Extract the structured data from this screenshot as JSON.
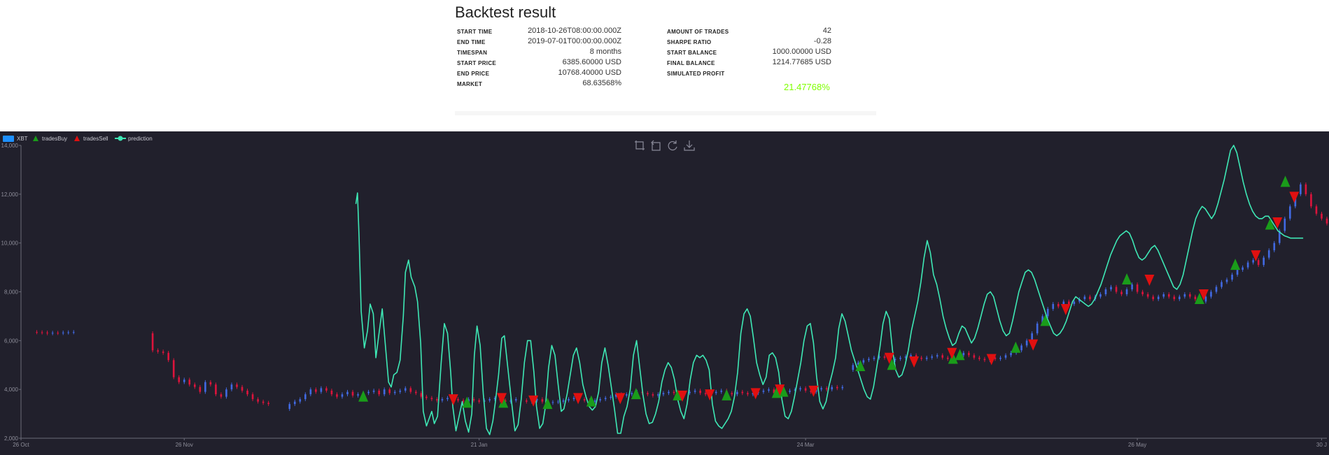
{
  "report": {
    "title": "Backtest result",
    "left_stats": [
      {
        "label": "START TIME",
        "value": "2018-10-26T08:00:00.000Z"
      },
      {
        "label": "END TIME",
        "value": "2019-07-01T00:00:00.000Z"
      },
      {
        "label": "TIMESPAN",
        "value": "8 months"
      },
      {
        "label": "START PRICE",
        "value": "6385.60000 USD"
      },
      {
        "label": "END PRICE",
        "value": "10768.40000 USD"
      },
      {
        "label": "MARKET",
        "value": "68.63568%"
      }
    ],
    "right_stats": [
      {
        "label": "AMOUNT OF TRADES",
        "value": "42"
      },
      {
        "label": "SHARPE RATIO",
        "value": "-0.28"
      },
      {
        "label": "START BALANCE",
        "value": "1000.00000 USD"
      },
      {
        "label": "FINAL BALANCE",
        "value": "1214.77685 USD"
      },
      {
        "label": "SIMULATED PROFIT",
        "value": ""
      }
    ],
    "profit": "21.47768%",
    "profit_color": "#7fff00"
  },
  "toolbox": {
    "icons": [
      "zoom-icon",
      "zoom-reset-icon",
      "restore-icon",
      "save-image-icon"
    ]
  },
  "chart_data": {
    "type": "line",
    "title": "",
    "xlabel": "",
    "ylabel": "",
    "ylim": [
      2000,
      14000
    ],
    "yticks": [
      2000,
      4000,
      6000,
      8000,
      10000,
      12000,
      14000
    ],
    "ytick_labels": [
      "2,000",
      "4,000",
      "6,000",
      "8,000",
      "10,000",
      "12,000",
      "14,000"
    ],
    "xlim_day": [
      0,
      248
    ],
    "xticks": [
      {
        "day": 0,
        "label": "26 Oct"
      },
      {
        "day": 31,
        "label": "26 Nov"
      },
      {
        "day": 87,
        "label": "21 Jan"
      },
      {
        "day": 149,
        "label": "24 Mar"
      },
      {
        "day": 212,
        "label": "26 May"
      },
      {
        "day": 247,
        "label": "30 J"
      }
    ],
    "legend": {
      "position": "top-left",
      "items": [
        {
          "name": "XBT",
          "kind": "candle",
          "color": "#1e90ff"
        },
        {
          "name": "tradesBuy",
          "kind": "triangle-up",
          "color": "#1a9c1a"
        },
        {
          "name": "tradesSell",
          "kind": "triangle-down",
          "color": "#e01010"
        },
        {
          "name": "prediction",
          "kind": "line",
          "color": "#3ee8b5"
        }
      ]
    },
    "colors": {
      "up": "#4169e1",
      "down": "#dc143c",
      "buy": "#1a9c1a",
      "sell": "#e01010",
      "prediction": "#3ee8b5"
    },
    "price_segments": [
      {
        "start": 2,
        "end": 10,
        "points": [
          6350,
          6340,
          6330,
          6300,
          6320,
          6310,
          6330,
          6340,
          6350
        ]
      },
      {
        "start": 24,
        "end": 47,
        "points": [
          6300,
          5600,
          5550,
          5500,
          5200,
          4500,
          4300,
          4400,
          4200,
          4100,
          3900,
          4300,
          4200,
          3800,
          3700,
          4000,
          4200,
          4100,
          3950,
          3800,
          3600,
          3500,
          3450,
          3400
        ]
      },
      {
        "start": 50,
        "end": 94,
        "points": [
          3200,
          3400,
          3500,
          3600,
          3800,
          4000,
          3900,
          4050,
          3950,
          3800,
          3700,
          3800,
          3900,
          3750,
          3800,
          3850,
          3900,
          3950,
          3800,
          4000,
          3850,
          3900,
          3950,
          4050,
          3900,
          3850,
          3700,
          3650,
          3600,
          3550,
          3600,
          3650,
          3600,
          3550,
          3500,
          3600,
          3550,
          3500,
          3550,
          3600,
          3650,
          3550,
          3500,
          3550,
          3600
        ]
      },
      {
        "start": 95,
        "end": 156,
        "points": [
          3550,
          3500,
          3550,
          3600,
          3500,
          3450,
          3480,
          3500,
          3550,
          3600,
          3650,
          3600,
          3550,
          3500,
          3550,
          3600,
          3650,
          3700,
          3800,
          3750,
          3800,
          3850,
          3900,
          3850,
          3800,
          3750,
          3800,
          3850,
          3900,
          3850,
          3800,
          3850,
          3900,
          3950,
          3850,
          3800,
          3850,
          3900,
          3950,
          3850,
          3800,
          3900,
          3850,
          3800,
          3850,
          3900,
          3950,
          4000,
          3850,
          3800,
          3900,
          3950,
          4000,
          4050,
          3950,
          3900,
          4000,
          4050,
          4000,
          4100,
          4050,
          4100
        ]
      },
      {
        "start": 157,
        "end": 248,
        "points": [
          4800,
          5000,
          5100,
          5200,
          5250,
          5300,
          5350,
          5300,
          5200,
          5250,
          5300,
          5350,
          5400,
          5300,
          5250,
          5300,
          5350,
          5400,
          5300,
          5250,
          5300,
          5400,
          5500,
          5400,
          5300,
          5250,
          5200,
          5300,
          5250,
          5300,
          5400,
          5500,
          5600,
          5800,
          6000,
          6300,
          6700,
          7000,
          7300,
          7500,
          7400,
          7600,
          7500,
          7600,
          7700,
          7800,
          7700,
          7800,
          7900,
          8100,
          8200,
          8000,
          7900,
          8100,
          8300,
          8000,
          7900,
          7800,
          7700,
          7800,
          7900,
          7800,
          7700,
          7800,
          7900,
          7800,
          7700,
          7600,
          7800,
          8000,
          8200,
          8400,
          8500,
          8700,
          8900,
          9000,
          9200,
          9300,
          9100,
          9400,
          9700,
          10000,
          10500,
          11000,
          11500,
          12000,
          12400,
          12000,
          11500,
          11200,
          11000,
          10800
        ]
      }
    ],
    "prediction": {
      "x": [
        63.6,
        63.9,
        64.2,
        64.6,
        65.2,
        65.8,
        66.3,
        66.9,
        67.4,
        68.0,
        68.6,
        69.2,
        69.8,
        70.3,
        70.8,
        71.4,
        72.0,
        72.6,
        73.0,
        73.6,
        74.1,
        74.8,
        75.3,
        75.9,
        76.4,
        77.0,
        77.5,
        78.0,
        78.5,
        79.1,
        79.8,
        80.4,
        81.0,
        81.6,
        82.0,
        82.6,
        83.2,
        83.8,
        84.4,
        85.0,
        85.6,
        86.1,
        86.6,
        87.2,
        87.8,
        88.4,
        89.0,
        89.6,
        90.1,
        90.7,
        91.3,
        91.8,
        92.4,
        93.1,
        93.8,
        94.4,
        95.0,
        95.6,
        96.2,
        96.8,
        97.4,
        97.9,
        98.5,
        99.1,
        99.6,
        100.2,
        100.8,
        101.4,
        102.0,
        102.6,
        103.1,
        103.7,
        104.3,
        104.9,
        105.5,
        106.1,
        106.7,
        107.3,
        107.9,
        108.5,
        109.1,
        109.7,
        110.3,
        110.9,
        111.5,
        112.1,
        112.7,
        113.3,
        113.9,
        114.5,
        115.1,
        115.7,
        116.3,
        116.9,
        117.5,
        118.1,
        118.7,
        119.3,
        119.9,
        120.5,
        121.1,
        121.7,
        122.3,
        122.9,
        123.5,
        124.1,
        124.7,
        125.3,
        125.9,
        126.5,
        127.1,
        127.7,
        128.3,
        128.9,
        129.5,
        130.1,
        130.7,
        131.3,
        131.9,
        132.5,
        133.1,
        133.7,
        134.3,
        134.9,
        135.5,
        136.1,
        136.7,
        137.3,
        137.9,
        138.5,
        139.1,
        139.7,
        140.3,
        140.9,
        141.5,
        142.1,
        142.7,
        143.3,
        143.9,
        144.5,
        145.1,
        145.7,
        146.3,
        146.9,
        147.5,
        148.1,
        148.7,
        149.3,
        149.9,
        150.5,
        151.1,
        151.7,
        152.3,
        152.9,
        153.5,
        154.1,
        154.7,
        155.3,
        155.9,
        156.5,
        157.1,
        157.7,
        158.3,
        158.9,
        159.5,
        160.1,
        160.7,
        161.3,
        161.9,
        162.5,
        163.1,
        163.7,
        164.3,
        164.9,
        165.5,
        166.1,
        166.7,
        167.3,
        167.9,
        168.5,
        169.1,
        169.7,
        170.3,
        170.9,
        171.5,
        172.1,
        172.7,
        173.3,
        173.9,
        174.5,
        175.1,
        175.7,
        176.3,
        176.9,
        177.5,
        178.1,
        178.7,
        179.3,
        179.9,
        180.5,
        181.1,
        181.7,
        182.3,
        182.9,
        183.5,
        184.1,
        184.7,
        185.3,
        185.9,
        186.5,
        187.1,
        187.7,
        188.3,
        188.9,
        189.5,
        190.1,
        190.7,
        191.3,
        191.9,
        192.5,
        193.1,
        193.7,
        194.3,
        194.9,
        195.5,
        196.1,
        196.7,
        197.3,
        197.9,
        198.5,
        199.1,
        199.7,
        200.3,
        200.9,
        201.5,
        202.1,
        202.7,
        203.3,
        203.9,
        204.5,
        205.1,
        205.7,
        206.3,
        206.9,
        207.5,
        208.1,
        208.7,
        209.3,
        209.9,
        210.5,
        211.1,
        211.7,
        212.3,
        212.9,
        213.5,
        214.1,
        214.7,
        215.3,
        215.9,
        216.5,
        217.1,
        217.7,
        218.3,
        218.9,
        219.5,
        220.1,
        220.7,
        221.3,
        221.9,
        222.5,
        223.1,
        223.7,
        224.3,
        224.9,
        225.5,
        226.1,
        226.7,
        227.3,
        227.9,
        228.5,
        229.1,
        229.7,
        230.3,
        230.9,
        231.5,
        232.1,
        232.7,
        233.3,
        233.9,
        234.5,
        235.1,
        235.7,
        236.3,
        236.9,
        237.5,
        238.1,
        238.7,
        239.3,
        239.9,
        240.5,
        241.1,
        241.7,
        242.3,
        242.9,
        243.5,
        244.1,
        244.7,
        245.3,
        245.9,
        246.5,
        247.1,
        247.7
      ],
      "values": [
        11600,
        12050,
        10200,
        7200,
        5700,
        6400,
        7500,
        7100,
        5300,
        6300,
        7300,
        5800,
        4300,
        4100,
        4600,
        4700,
        5200,
        7000,
        8800,
        9300,
        8600,
        8200,
        7600,
        5900,
        3100,
        2500,
        2800,
        3100,
        2600,
        2900,
        5100,
        6700,
        6300,
        4700,
        3300,
        2300,
        2900,
        3500,
        2700,
        2250,
        3000,
        5400,
        6600,
        5800,
        3800,
        2400,
        2150,
        2700,
        3500,
        4600,
        6100,
        6200,
        5000,
        3600,
        2300,
        2550,
        3600,
        5100,
        6000,
        6000,
        4700,
        3300,
        2400,
        2600,
        3300,
        4900,
        5800,
        5400,
        4200,
        3100,
        3200,
        3800,
        4600,
        5400,
        5700,
        5100,
        4200,
        3700,
        3300,
        3150,
        3300,
        3900,
        5100,
        5700,
        5000,
        4100,
        3200,
        2200,
        2200,
        2900,
        3300,
        4000,
        5400,
        6000,
        4900,
        3800,
        3000,
        2600,
        2650,
        3000,
        3500,
        4300,
        4800,
        5100,
        4900,
        4400,
        3600,
        3100,
        2800,
        3400,
        4400,
        5100,
        5400,
        5300,
        5400,
        5200,
        4800,
        3400,
        2700,
        2500,
        2400,
        2600,
        2800,
        3100,
        3700,
        4700,
        6300,
        7100,
        7300,
        7000,
        6100,
        5100,
        4600,
        4200,
        4500,
        5400,
        5500,
        5300,
        4700,
        3600,
        2900,
        2800,
        3100,
        3700,
        4400,
        5100,
        6000,
        6600,
        6700,
        5900,
        4500,
        3500,
        3200,
        3500,
        4200,
        4700,
        5300,
        6500,
        7100,
        6800,
        6200,
        5600,
        5200,
        4800,
        4400,
        4000,
        3700,
        3600,
        4100,
        4900,
        5700,
        6700,
        7200,
        6900,
        5600,
        4800,
        4500,
        4600,
        5000,
        5600,
        6400,
        7000,
        7600,
        8400,
        9400,
        10100,
        9600,
        8700,
        8300,
        7700,
        7000,
        6500,
        6100,
        5800,
        5900,
        6300,
        6600,
        6500,
        6200,
        5900,
        6100,
        6500,
        7000,
        7500,
        7900,
        8000,
        7800,
        7300,
        6800,
        6400,
        6200,
        6300,
        6800,
        7400,
        8000,
        8400,
        8800,
        8900,
        8800,
        8500,
        8100,
        7700,
        7300,
        6900,
        6600,
        6300,
        6200,
        6300,
        6500,
        6800,
        7200,
        7600,
        7800,
        7700,
        7600,
        7500,
        7400,
        7500,
        7700,
        8000,
        8300,
        8700,
        9100,
        9500,
        9800,
        10100,
        10300,
        10400,
        10500,
        10400,
        10100,
        9700,
        9400,
        9300,
        9400,
        9600,
        9800,
        9900,
        9700,
        9400,
        9100,
        8800,
        8500,
        8200,
        8100,
        8300,
        8700,
        9300,
        9900,
        10500,
        11000,
        11300,
        11500,
        11400,
        11200,
        11000,
        11200,
        11600,
        12100,
        12600,
        13200,
        13800,
        14000,
        13700,
        13100,
        12500,
        12000,
        11600,
        11300,
        11100,
        11000,
        11000,
        11100,
        11100,
        10900,
        10700,
        10500,
        10400,
        10300,
        10250,
        10200,
        10200,
        10200,
        10200,
        10200
      ]
    },
    "trades_buy": [
      [
        65.0,
        3700
      ],
      [
        84.7,
        3450
      ],
      [
        91.6,
        3450
      ],
      [
        100.0,
        3400
      ],
      [
        108.3,
        3500
      ],
      [
        116.8,
        3800
      ],
      [
        124.7,
        3750
      ],
      [
        134.0,
        3750
      ],
      [
        143.5,
        3850
      ],
      [
        144.8,
        3900
      ],
      [
        159.4,
        4950
      ],
      [
        165.4,
        5000
      ],
      [
        177.0,
        5250
      ],
      [
        178.3,
        5400
      ],
      [
        188.9,
        5700
      ],
      [
        194.5,
        6800
      ],
      [
        210.0,
        8500
      ],
      [
        223.8,
        7700
      ],
      [
        230.6,
        9100
      ],
      [
        237.2,
        10750
      ],
      [
        240.1,
        12500
      ]
    ],
    "trades_sell": [
      [
        82.1,
        3600
      ],
      [
        91.3,
        3650
      ],
      [
        97.3,
        3550
      ],
      [
        105.8,
        3650
      ],
      [
        113.8,
        3650
      ],
      [
        125.6,
        3750
      ],
      [
        130.8,
        3800
      ],
      [
        139.5,
        3850
      ],
      [
        144.1,
        4000
      ],
      [
        150.5,
        3950
      ],
      [
        164.9,
        5300
      ],
      [
        169.6,
        5150
      ],
      [
        176.8,
        5500
      ],
      [
        184.3,
        5250
      ],
      [
        192.2,
        5850
      ],
      [
        198.4,
        7300
      ],
      [
        214.3,
        8500
      ],
      [
        224.6,
        7900
      ],
      [
        234.5,
        9500
      ],
      [
        238.6,
        10850
      ],
      [
        241.8,
        11900
      ]
    ]
  }
}
